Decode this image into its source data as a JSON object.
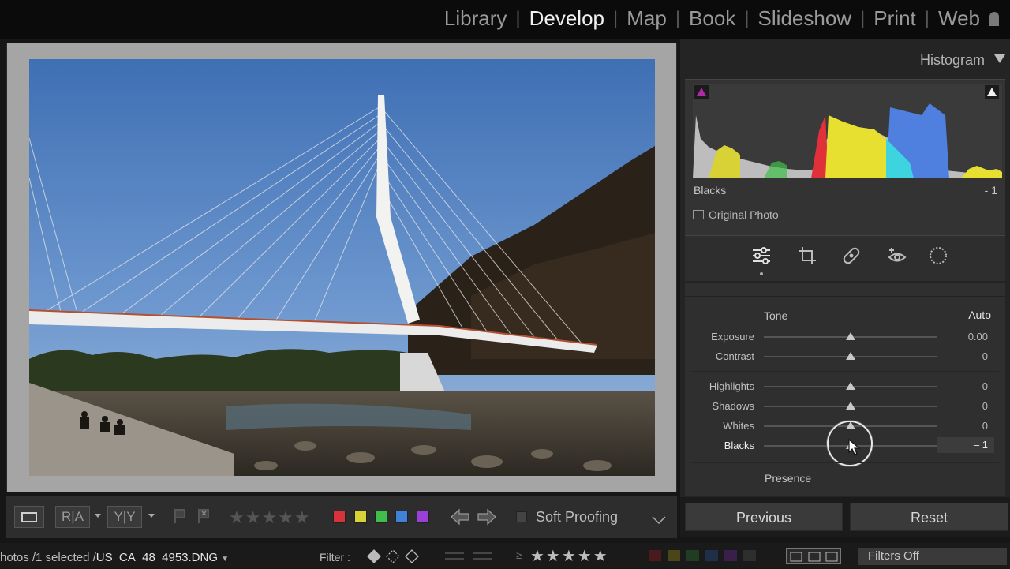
{
  "modules": {
    "items": [
      "Library",
      "Develop",
      "Map",
      "Book",
      "Slideshow",
      "Print",
      "Web"
    ],
    "active": "Develop"
  },
  "histogram": {
    "title": "Histogram",
    "readout_label": "Blacks",
    "readout_value": "- 1",
    "original_photo_label": "Original Photo"
  },
  "basic": {
    "tone_label": "Tone",
    "auto_label": "Auto",
    "presence_label": "Presence",
    "sliders": [
      {
        "label": "Exposure",
        "value": "0.00"
      },
      {
        "label": "Contrast",
        "value": "0"
      },
      {
        "label": "Highlights",
        "value": "0"
      },
      {
        "label": "Shadows",
        "value": "0"
      },
      {
        "label": "Whites",
        "value": "0"
      },
      {
        "label": "Blacks",
        "value": "– 1"
      }
    ]
  },
  "buttons": {
    "previous": "Previous",
    "reset": "Reset"
  },
  "toolbar": {
    "before_after_label": "R|A",
    "yy_label": "Y|Y",
    "soft_proofing": "Soft Proofing",
    "color_labels": [
      "#d8323a",
      "#d9d236",
      "#3fbf4a",
      "#3f82d8",
      "#9a3fd8"
    ]
  },
  "filmstrip": {
    "path_prefix": "hotos /1 selected /",
    "filename": "US_CA_48_4953.DNG",
    "filter_label": "Filter :",
    "filters_off": "Filters Off"
  },
  "colors": {
    "accent_active": "#f0f0f0",
    "panel_bg": "#242424"
  }
}
